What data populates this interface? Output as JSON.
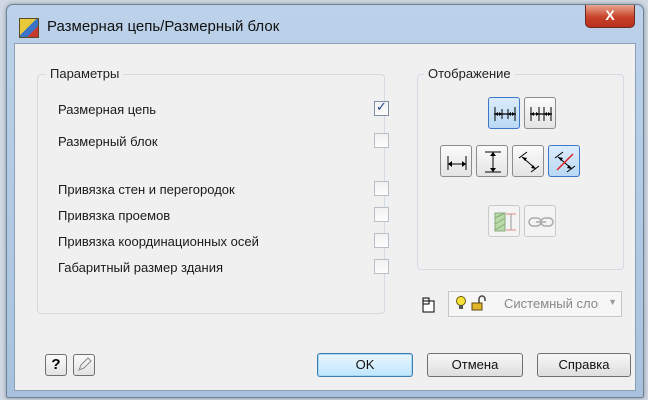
{
  "window": {
    "title": "Размерная цепь/Размерный блок",
    "close_label": "X"
  },
  "params": {
    "caption": "Параметры",
    "items": [
      {
        "label": "Размерная цепь",
        "checked": true
      },
      {
        "label": "Размерный блок",
        "checked": false
      },
      {
        "label": "Привязка стен и перегородок",
        "checked": false
      },
      {
        "label": "Привязка проемов",
        "checked": false
      },
      {
        "label": "Привязка координационных осей",
        "checked": false
      },
      {
        "label": "Габаритный размер здания",
        "checked": false
      }
    ]
  },
  "display": {
    "caption": "Отображение",
    "icons": [
      "chain-dims-icon",
      "chain-dims-alt-icon",
      "horizontal-dim-icon",
      "vertical-dim-icon",
      "aligned-dim-icon",
      "rotated-dim-icon",
      "dim-layer-props-icon",
      "link-chain-icon"
    ]
  },
  "layer": {
    "value": "Системный слой",
    "icons": [
      "layer-frame-icon",
      "lightbulb-icon",
      "unlock-icon"
    ]
  },
  "footer": {
    "help_icon": "?",
    "ok": "OK",
    "cancel": "Отмена",
    "help": "Справка"
  }
}
